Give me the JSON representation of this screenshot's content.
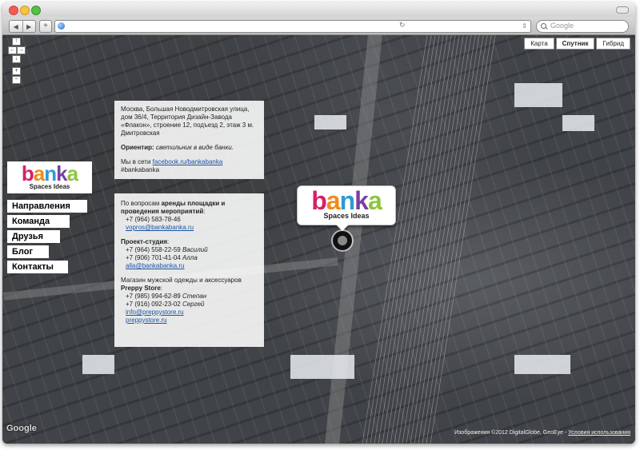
{
  "browser": {
    "search_placeholder": "Google"
  },
  "map_controls": {
    "pan_up": "↑",
    "pan_left": "←",
    "pan_right": "→",
    "pan_down": "↓",
    "zoom_in": "+",
    "zoom_out": "−",
    "map_types": [
      {
        "label": "Карта",
        "active": false
      },
      {
        "label": "Спутник",
        "active": true
      },
      {
        "label": "Гибрид",
        "active": false
      }
    ]
  },
  "logo": {
    "letters": [
      "b",
      "a",
      "n",
      "k",
      "a"
    ],
    "subtitle": "Spaces Ideas",
    "colors": [
      "#d6206b",
      "#f08a1c",
      "#2e9ad3",
      "#7a3fa3",
      "#8cc63f"
    ]
  },
  "menu": [
    {
      "label": "Направления"
    },
    {
      "label": "Команда"
    },
    {
      "label": "Друзья"
    },
    {
      "label": "Блог"
    },
    {
      "label": "Контакты"
    }
  ],
  "address_card": {
    "address": "Москва, Большая Новодмитровская улица, дом 36/4, Территория Дизайн-Завода «Флакон», строение 12, подъезд 2, этаж 3 м. Дмитровская",
    "landmark_label": "Ориентир:",
    "landmark_value": "светильник в виде банки.",
    "social_prefix": "Мы в сети",
    "social_link": "facebook.ru/bankabanka",
    "hashtag": "#bankabanka"
  },
  "contacts_card": {
    "rent_intro_prefix": "По вопросам",
    "rent_intro_bold": "аренды площадки и проведения мероприятий",
    "rent_intro_suffix": ":",
    "rent_phone": "+7 (964) 583-78-46",
    "rent_email": "vopros@bankabanka.ru",
    "studio_label": "Проект-студия",
    "studio_label_suffix": ":",
    "studio_phone1": "+7 (964) 558-22-59",
    "studio_name1": "Василий",
    "studio_phone2": "+7 (906) 701-41-04",
    "studio_name2": "Алла",
    "studio_email": "alla@bankabanka.ru",
    "store_intro": "Магазин мужской одежды и аксессуаров",
    "store_name": "Preppy Store",
    "store_name_suffix": ":",
    "store_phone1": "+7 (985) 994-62-89",
    "store_name1": "Степан",
    "store_phone2": "+7 (916) 092-23-02",
    "store_name2": "Сергей",
    "store_email": "info@preppystore.ru",
    "store_site": "preppystore.ru"
  },
  "footer": {
    "google_logo": "Google",
    "attribution": "Изображения ©2012 DigitalGlobe, GeoEye -",
    "terms_link": "Условия использования"
  }
}
